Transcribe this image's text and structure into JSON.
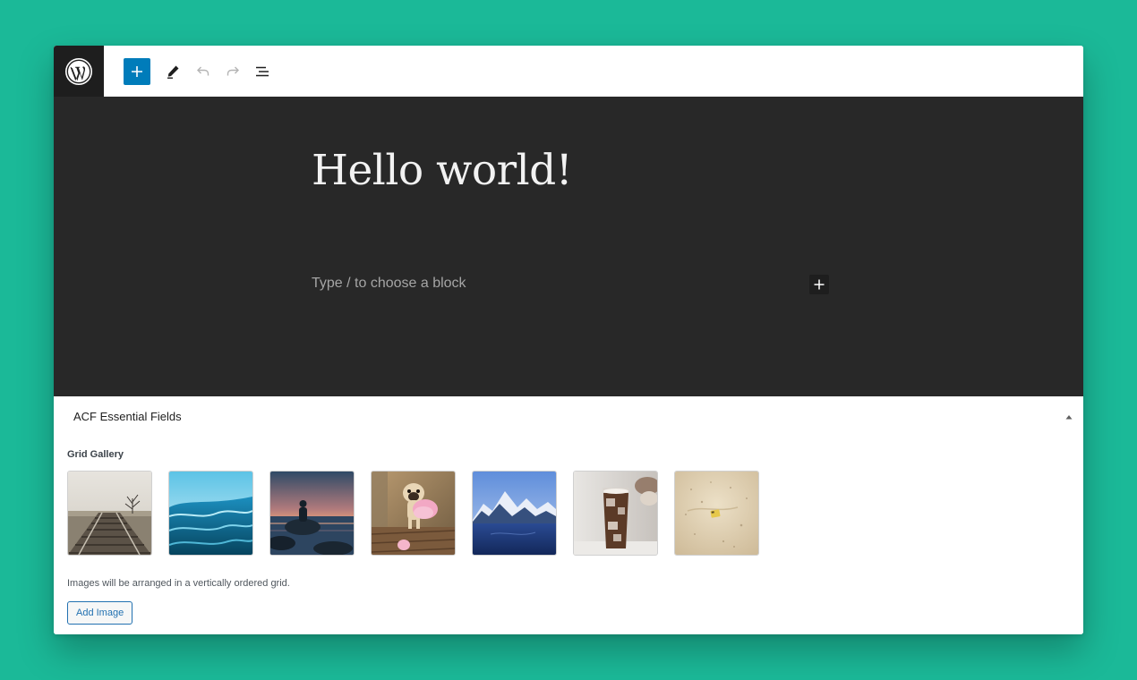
{
  "toolbar": {
    "logo_icon": "wordpress-logo-icon",
    "add_block_icon": "plus-icon",
    "tools_icon": "pencil-icon",
    "undo_icon": "undo-icon",
    "redo_icon": "redo-icon",
    "list_view_icon": "list-view-icon",
    "accent_color": "#007cba"
  },
  "editor": {
    "title": "Hello world!",
    "block_placeholder": "Type / to choose a block",
    "inserter_icon": "plus-icon",
    "canvas_color": "#282828"
  },
  "metabox": {
    "title": "ACF Essential Fields",
    "toggle_icon": "triangle-up-icon",
    "field_label": "Grid Gallery",
    "images": [
      {
        "subject": "railroad-tracks"
      },
      {
        "subject": "ocean-wave"
      },
      {
        "subject": "person-on-rock-at-sunset"
      },
      {
        "subject": "pug-in-pink-dress"
      },
      {
        "subject": "snowy-mountain-lake"
      },
      {
        "subject": "iced-coffee-glass"
      },
      {
        "subject": "sand-with-small-object"
      }
    ],
    "help_text": "Images will be arranged in a vertically ordered grid.",
    "add_button_label": "Add Image",
    "button_color": "#2271b1"
  },
  "background_color": "#1bb998"
}
